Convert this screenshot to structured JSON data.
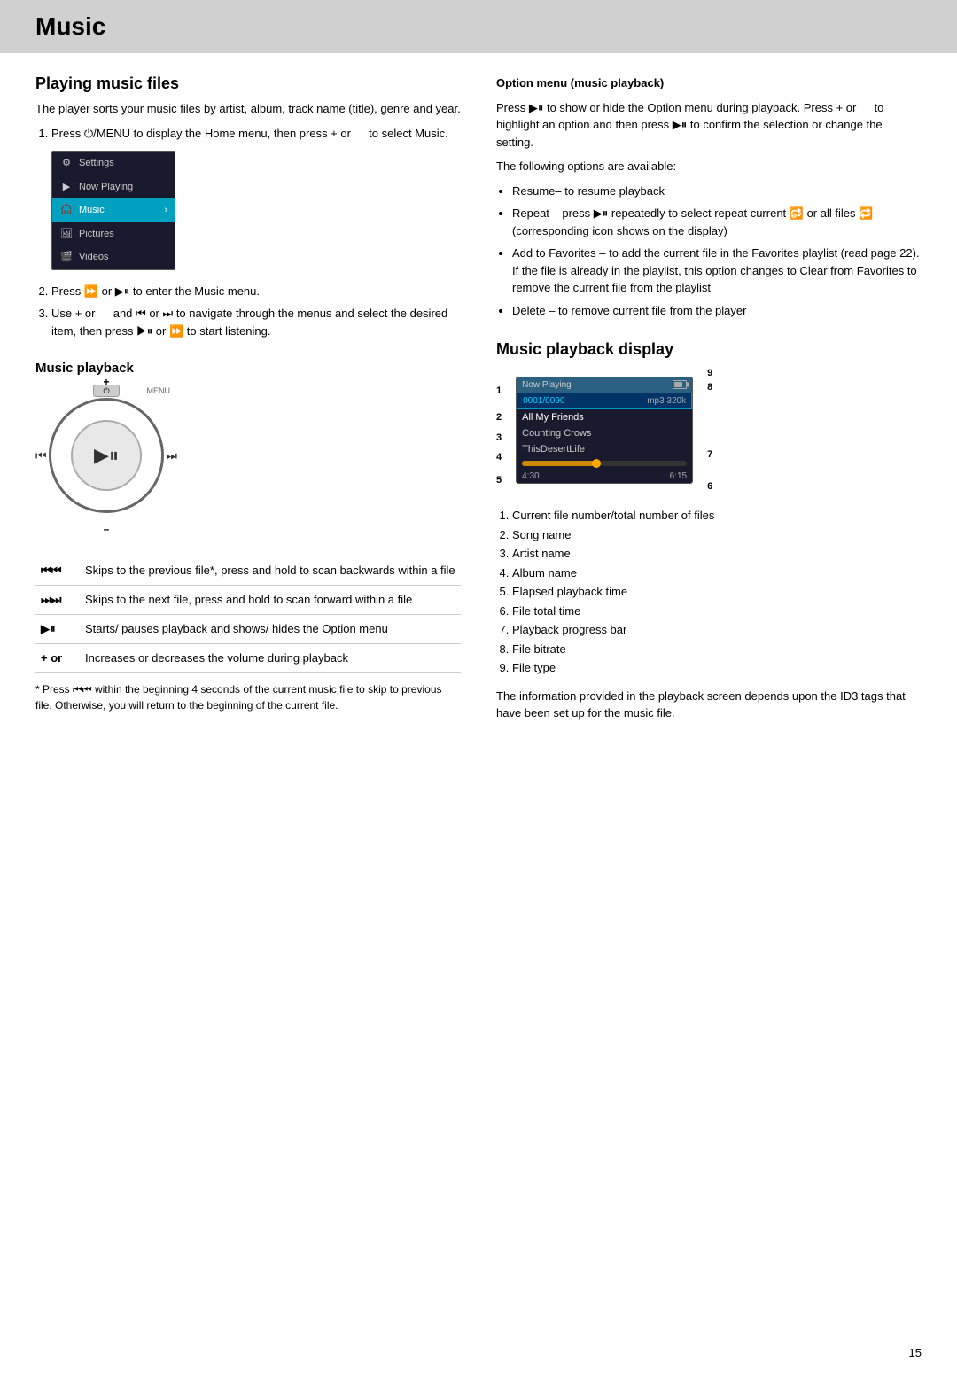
{
  "page": {
    "title": "Music",
    "number": "15"
  },
  "left": {
    "playing_files": {
      "heading": "Playing music files",
      "description": "The player sorts your music files by artist, album, track name (title), genre and year.",
      "steps": [
        "Press ⏻/MENU to display the Home menu, then press + or    to select Music.",
        "Press ⏩ or ▶⏸ to enter the Music menu.",
        "Use + or   and ⏮ or ⏭ to navigate through the menus and select the desired item, then press ▶⏸ or ⏩ to start listening."
      ]
    },
    "music_playback": {
      "heading": "Music playback"
    },
    "controls": [
      {
        "symbol": "⏮⏮",
        "description": "Skips to the previous file*, press and hold to scan backwards within a file"
      },
      {
        "symbol": "⏭⏭",
        "description": "Skips to the next file, press and hold to scan forward within a file"
      },
      {
        "symbol": "▶⏸",
        "description": "Starts/ pauses playback and shows/ hides the Option menu"
      },
      {
        "symbol": "+ or",
        "description": "Increases or decreases the volume during playback"
      }
    ],
    "footnote": "* Press ⏮⏮ within the beginning 4 seconds of the current music file to skip to previous file. Otherwise, you will return to the beginning of the current file."
  },
  "right": {
    "option_menu": {
      "heading": "Option menu (music playback)",
      "description1": "Press ▶⏸ to show or hide the Option menu during playback. Press + or   to highlight an option and then press ▶⏸ to confirm the selection or change the setting.",
      "description2": "The following options are available:",
      "options": [
        "Resume– to resume playback",
        "Repeat – press ▶⏸ repeatedly to select repeat current 🔂 or all files 🔁  (corresponding icon shows on the display)",
        "Add to Favorites – to add the current file in the Favorites playlist (read page 22). If the file is already in the playlist, this option changes to Clear from Favorites to remove the current file from the playlist",
        "Delete – to remove current file from the player"
      ]
    },
    "music_playback_display": {
      "heading": "Music playback display",
      "display": {
        "now_playing": "Now Playing",
        "track_num": "0001/0090",
        "format": "mp3 320k",
        "song": "All My Friends",
        "artist": "Counting Crows",
        "album": "ThisDesertLife",
        "elapsed": "4:30",
        "total": "6:15"
      },
      "numbered_items": [
        "Current file number/total number of files",
        "Song name",
        "Artist name",
        "Album name",
        "Elapsed playback time",
        "File total time",
        "Playback progress bar",
        "File bitrate",
        "File type"
      ]
    },
    "info_text": "The information provided in the playback screen depends upon the ID3 tags that have been set up for the music file."
  },
  "menu_items": [
    {
      "label": "Settings",
      "icon": "gear"
    },
    {
      "label": "Now Playing",
      "icon": "play"
    },
    {
      "label": "Music",
      "icon": "headphones",
      "active": true
    },
    {
      "label": "Pictures",
      "icon": "image"
    },
    {
      "label": "Videos",
      "icon": "video"
    }
  ]
}
